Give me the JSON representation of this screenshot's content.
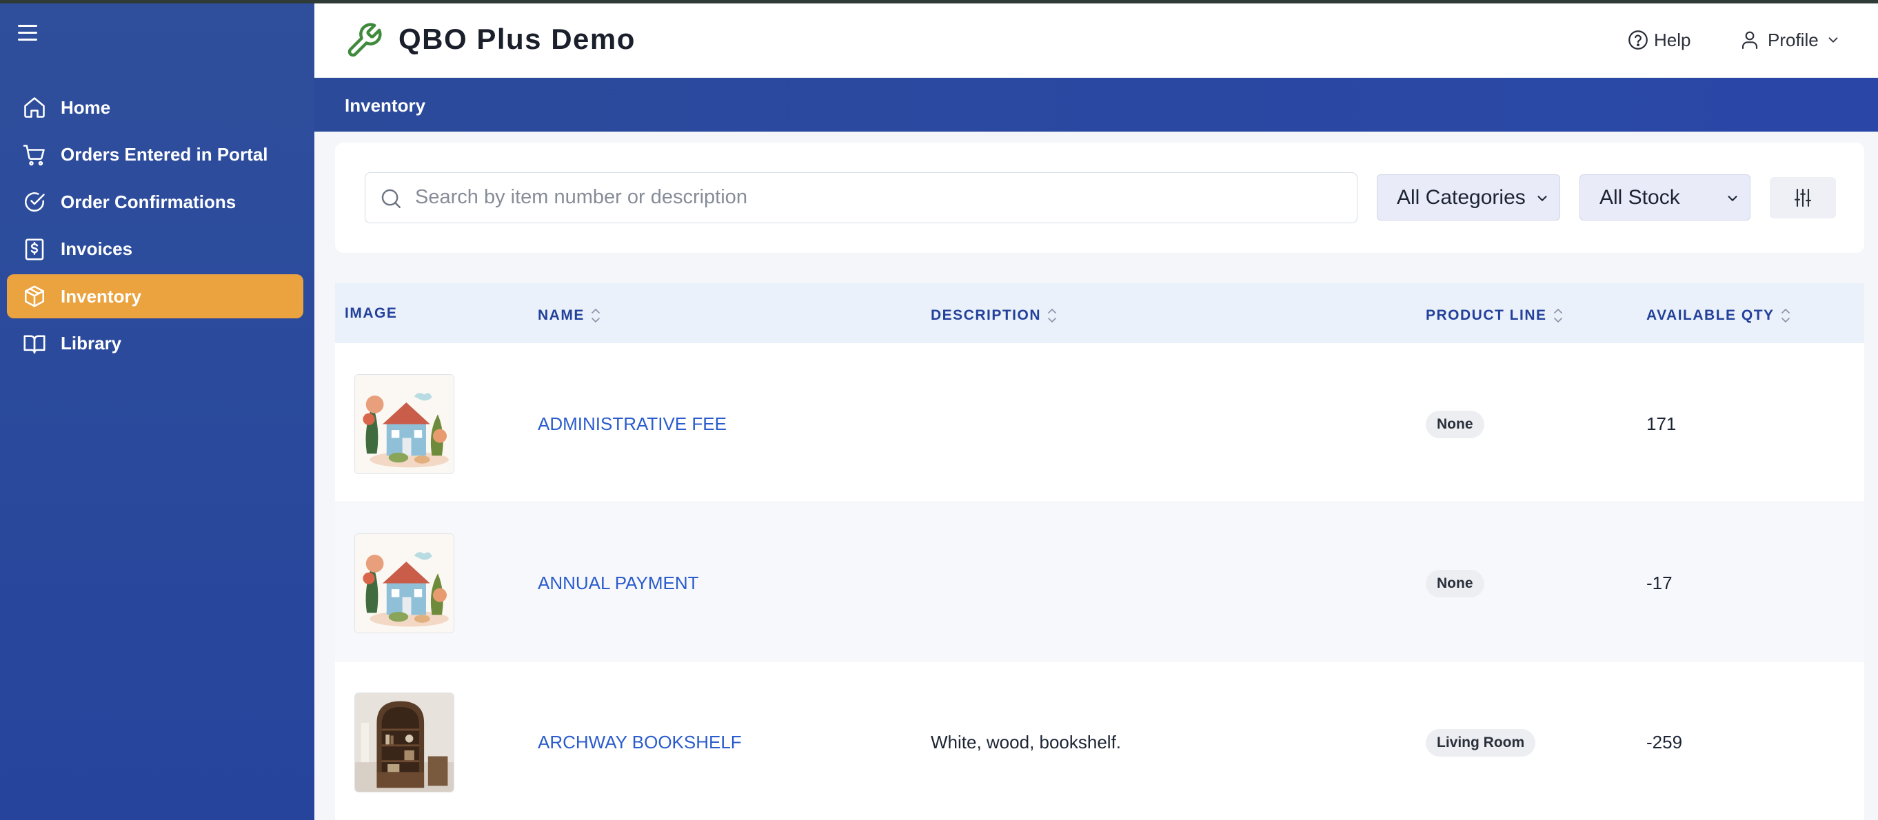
{
  "app": {
    "title": "QBO Plus Demo"
  },
  "header": {
    "help_label": "Help",
    "profile_label": "Profile"
  },
  "sidebar": {
    "items": [
      {
        "label": "Home",
        "icon": "home-icon",
        "active": false
      },
      {
        "label": "Orders Entered in Portal",
        "icon": "cart-icon",
        "active": false
      },
      {
        "label": "Order Confirmations",
        "icon": "check-circle-icon",
        "active": false
      },
      {
        "label": "Invoices",
        "icon": "invoice-icon",
        "active": false
      },
      {
        "label": "Inventory",
        "icon": "box-icon",
        "active": true
      },
      {
        "label": "Library",
        "icon": "book-icon",
        "active": false
      }
    ]
  },
  "page": {
    "title": "Inventory"
  },
  "filters": {
    "search_placeholder": "Search by item number or description",
    "search_value": "",
    "category_selected": "All Categories",
    "stock_selected": "All Stock"
  },
  "table": {
    "columns": [
      "IMAGE",
      "NAME",
      "DESCRIPTION",
      "PRODUCT LINE",
      "AVAILABLE QTY"
    ],
    "rows": [
      {
        "image": "house-illustration",
        "name": "ADMINISTRATIVE FEE",
        "description": "",
        "product_line": "None",
        "available_qty": "171"
      },
      {
        "image": "house-illustration",
        "name": "ANNUAL PAYMENT",
        "description": "",
        "product_line": "None",
        "available_qty": "-17"
      },
      {
        "image": "bookshelf-photo",
        "name": "ARCHWAY BOOKSHELF",
        "description": "White, wood, bookshelf.",
        "product_line": "Living Room",
        "available_qty": "-259"
      }
    ]
  },
  "colors": {
    "sidebar_bg": "#2a49a0",
    "active_item": "#eaa33e",
    "link": "#2b5ccd",
    "header_text": "#23409a"
  }
}
